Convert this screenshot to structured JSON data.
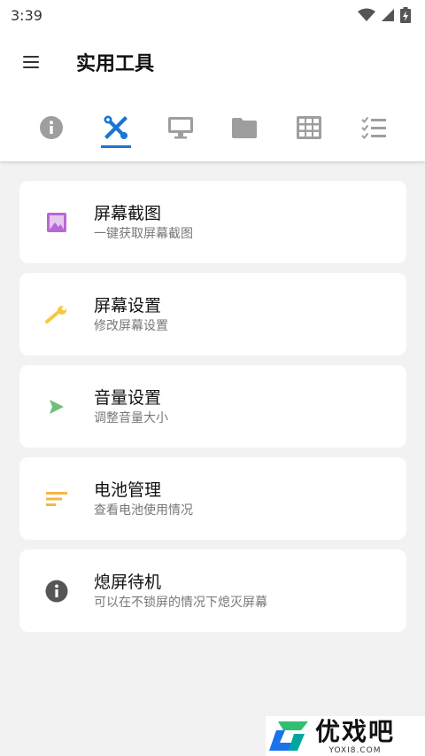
{
  "status_bar": {
    "time": "3:39"
  },
  "app_bar": {
    "title": "实用工具"
  },
  "tabs": [
    {
      "icon": "info-icon",
      "active": false
    },
    {
      "icon": "tools-icon",
      "active": true
    },
    {
      "icon": "monitor-icon",
      "active": false
    },
    {
      "icon": "folder-icon",
      "active": false
    },
    {
      "icon": "grid-icon",
      "active": false
    },
    {
      "icon": "checklist-icon",
      "active": false
    }
  ],
  "items": [
    {
      "icon": "image-icon",
      "icon_color": "#b867d6",
      "title": "屏幕截图",
      "subtitle": "一键获取屏幕截图"
    },
    {
      "icon": "wrench-icon",
      "icon_color": "#f5c842",
      "title": "屏幕设置",
      "subtitle": "修改屏幕设置"
    },
    {
      "icon": "play-icon",
      "icon_color": "#6fc07c",
      "title": "音量设置",
      "subtitle": "调整音量大小"
    },
    {
      "icon": "lines-icon",
      "icon_color": "#f6b645",
      "title": "电池管理",
      "subtitle": "查看电池使用情况"
    },
    {
      "icon": "info-circle-icon",
      "icon_color": "#555555",
      "title": "熄屏待机",
      "subtitle": "可以在不锁屏的情况下熄灭屏幕"
    }
  ],
  "watermark": {
    "text": "优戏吧",
    "url_text": "YOXI8.COM"
  },
  "colors": {
    "accent": "#1976d2",
    "tab_icon": "#9e9e9e",
    "background": "#f2f2f2"
  }
}
